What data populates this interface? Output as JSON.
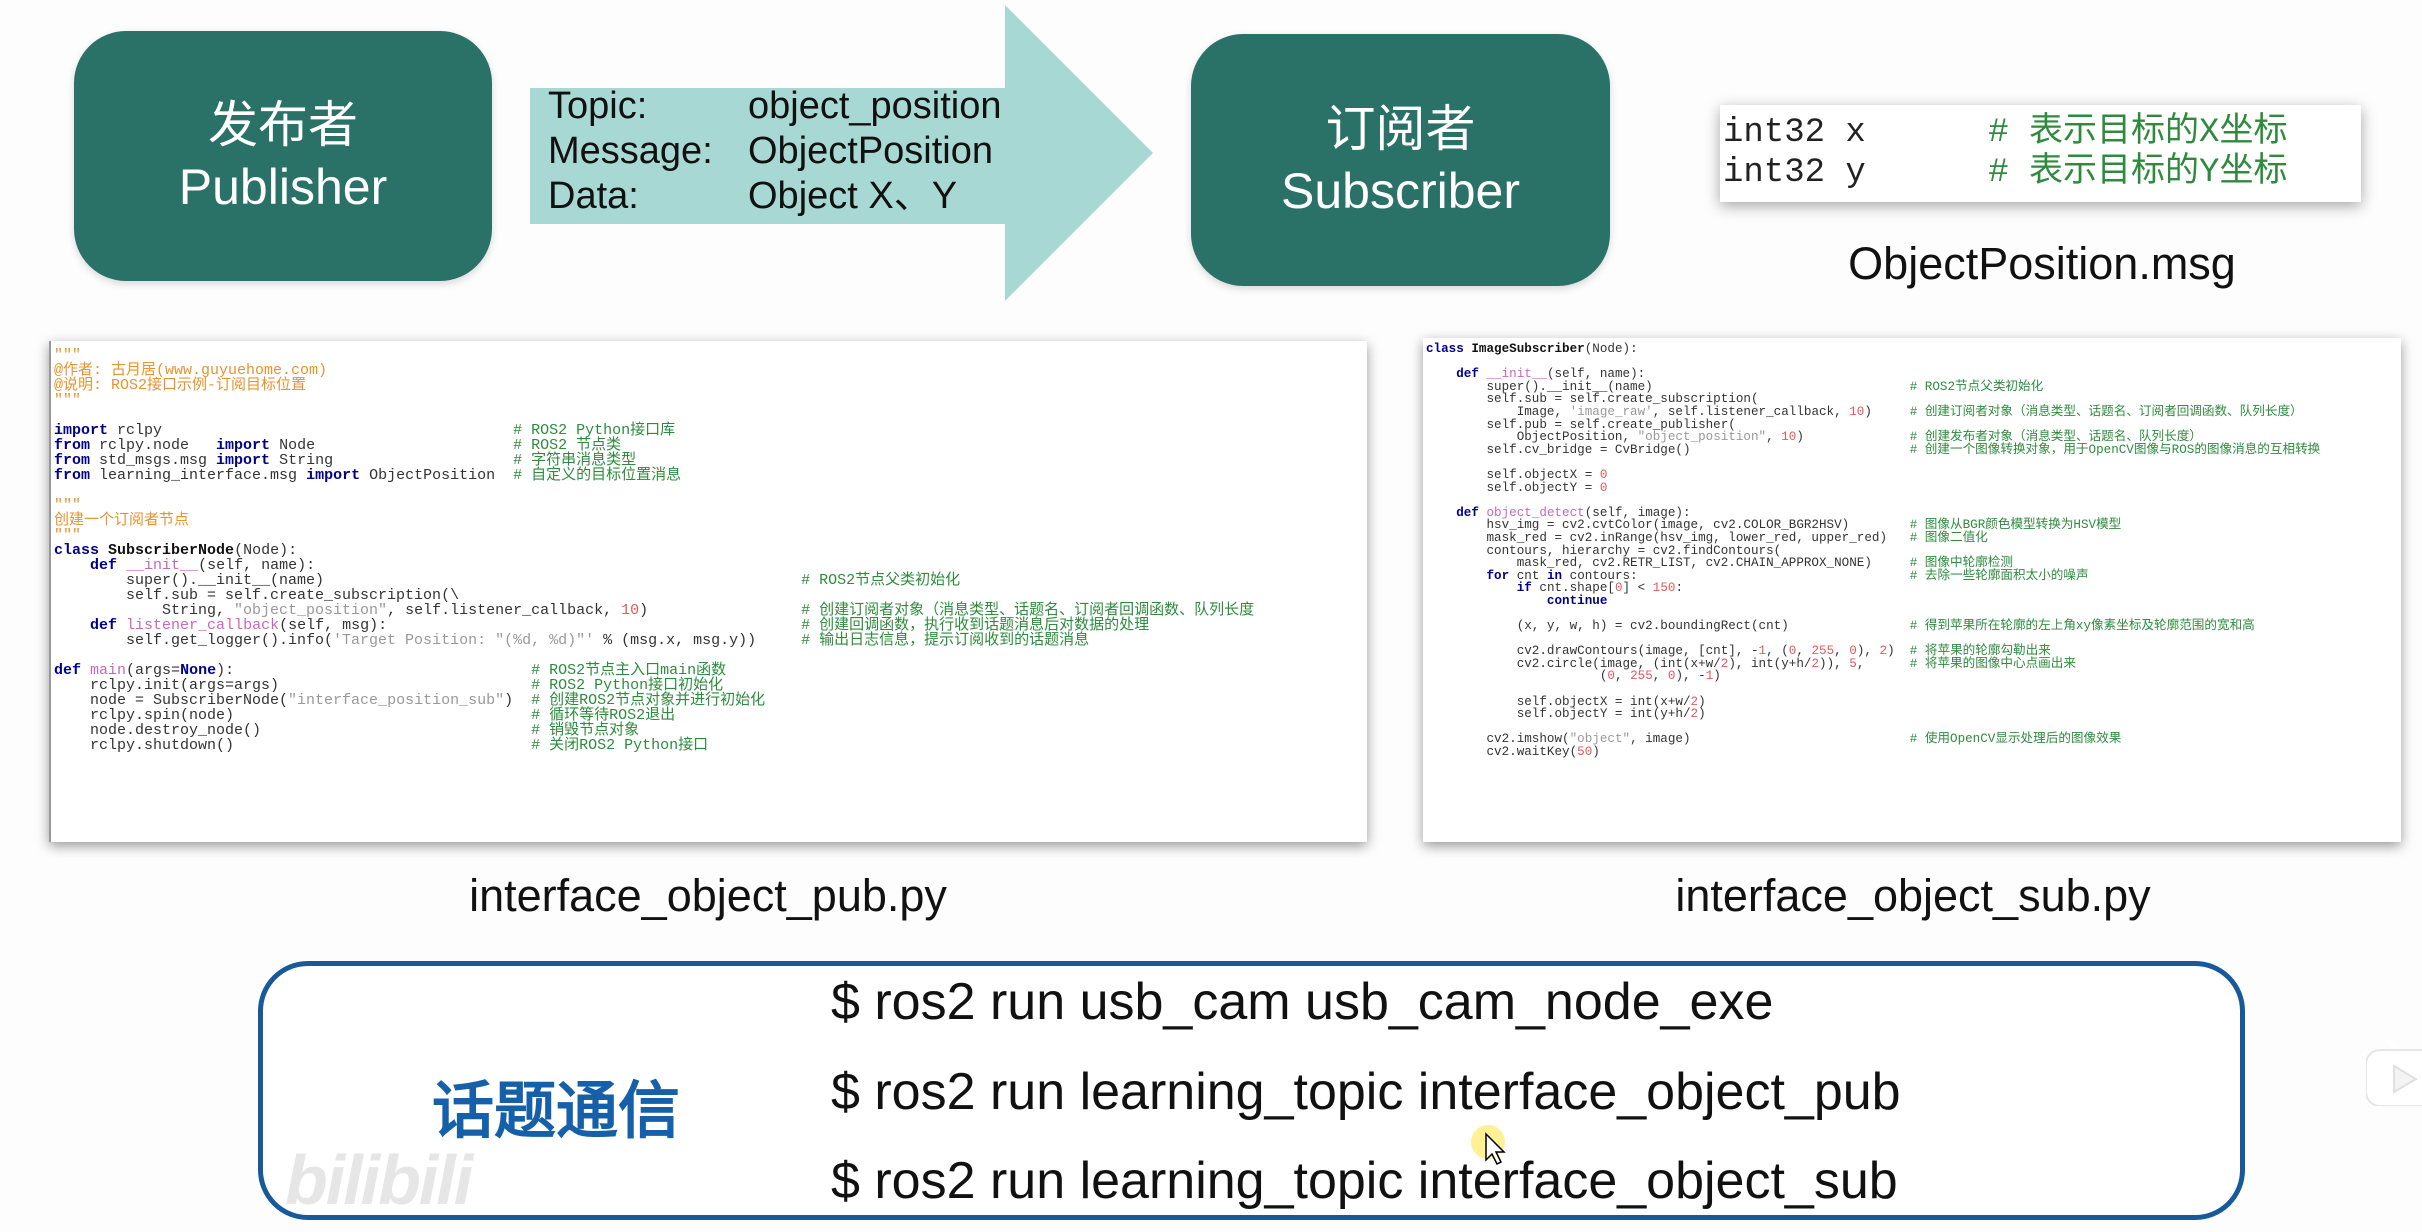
{
  "publisher": {
    "zh": "发布者",
    "en": "Publisher"
  },
  "subscriber": {
    "zh": "订阅者",
    "en": "Subscriber"
  },
  "topic_arrow": {
    "rows": [
      {
        "key": "Topic:",
        "value": "object_position"
      },
      {
        "key": "Message:",
        "value": "ObjectPosition"
      },
      {
        "key": "Data:",
        "value": "Object X、Y"
      }
    ]
  },
  "msg_file": {
    "lines": [
      {
        "code": "int32 x",
        "comment": "# 表示目标的X坐标"
      },
      {
        "code": "int32 y",
        "comment": "# 表示目标的Y坐标"
      }
    ],
    "caption": "ObjectPosition.msg"
  },
  "pub_code": {
    "caption": "interface_object_pub.py",
    "groups": [
      {
        "kind": "doc",
        "lines": [
          "\"\"\"",
          "@作者: 古月居(www.guyuehome.com)",
          "@说明: ROS2接口示例-订阅目标位置",
          "\"\"\"",
          ""
        ]
      },
      {
        "kind": "imports",
        "lines": [
          {
            "code": "import rclpy",
            "comment": "# ROS2 Python接口库"
          },
          {
            "code": "from rclpy.node   import Node",
            "comment": "# ROS2 节点类"
          },
          {
            "code": "from std_msgs.msg import String",
            "comment": "# 字符串消息类型"
          },
          {
            "code": "from learning_interface.msg import ObjectPosition",
            "comment": "# 自定义的目标位置消息"
          },
          {
            "code": "",
            "comment": ""
          }
        ]
      },
      {
        "kind": "doc",
        "lines": [
          "\"\"\"",
          "创建一个订阅者节点",
          "\"\"\""
        ]
      },
      {
        "kind": "class",
        "lines": [
          {
            "code": "class SubscriberNode(Node):",
            "comment": ""
          },
          {
            "code": "    def __init__(self, name):",
            "comment": ""
          },
          {
            "code": "        super().__init__(name)",
            "comment": "# ROS2节点父类初始化"
          },
          {
            "code": "        self.sub = self.create_subscription(\\",
            "comment": ""
          },
          {
            "code": "            String, \"object_position\", self.listener_callback, 10)",
            "comment": "# 创建订阅者对象（消息类型、话题名、订阅者回调函数、队列长度"
          },
          {
            "code": "    def listener_callback(self, msg):",
            "comment": "# 创建回调函数，执行收到话题消息后对数据的处理"
          },
          {
            "code": "        self.get_logger().info('Target Position: \"(%d, %d)\"' % (msg.x, msg.y))",
            "comment": "# 输出日志信息，提示订阅收到的话题消息"
          },
          {
            "code": "",
            "comment": ""
          }
        ]
      },
      {
        "kind": "main",
        "lines": [
          {
            "code": "def main(args=None):",
            "comment": "# ROS2节点主入口main函数"
          },
          {
            "code": "    rclpy.init(args=args)",
            "comment": "# ROS2 Python接口初始化"
          },
          {
            "code": "    node = SubscriberNode(\"interface_position_sub\")",
            "comment": "# 创建ROS2节点对象并进行初始化"
          },
          {
            "code": "    rclpy.spin(node)",
            "comment": "# 循环等待ROS2退出"
          },
          {
            "code": "    node.destroy_node()",
            "comment": "# 销毁节点对象"
          },
          {
            "code": "    rclpy.shutdown()",
            "comment": "# 关闭ROS2 Python接口"
          }
        ]
      }
    ]
  },
  "sub_code": {
    "caption": "interface_object_sub.py",
    "lines": [
      {
        "code": "class ImageSubscriber(Node):",
        "comment": ""
      },
      {
        "code": "",
        "comment": ""
      },
      {
        "code": "    def __init__(self, name):",
        "comment": ""
      },
      {
        "code": "        super().__init__(name)",
        "comment": "# ROS2节点父类初始化"
      },
      {
        "code": "        self.sub = self.create_subscription(",
        "comment": ""
      },
      {
        "code": "            Image, 'image_raw', self.listener_callback, 10)",
        "comment": "# 创建订阅者对象（消息类型、话题名、订阅者回调函数、队列长度）"
      },
      {
        "code": "        self.pub = self.create_publisher(",
        "comment": ""
      },
      {
        "code": "            ObjectPosition, \"object_position\", 10)",
        "comment": "# 创建发布者对象（消息类型、话题名、队列长度）"
      },
      {
        "code": "        self.cv_bridge = CvBridge()",
        "comment": "# 创建一个图像转换对象，用于OpenCV图像与ROS的图像消息的互相转换"
      },
      {
        "code": "",
        "comment": ""
      },
      {
        "code": "        self.objectX = 0",
        "comment": ""
      },
      {
        "code": "        self.objectY = 0",
        "comment": ""
      },
      {
        "code": "",
        "comment": ""
      },
      {
        "code": "    def object_detect(self, image):",
        "comment": ""
      },
      {
        "code": "        hsv_img = cv2.cvtColor(image, cv2.COLOR_BGR2HSV)",
        "comment": "# 图像从BGR颜色模型转换为HSV模型"
      },
      {
        "code": "        mask_red = cv2.inRange(hsv_img, lower_red, upper_red)",
        "comment": "# 图像二值化"
      },
      {
        "code": "        contours, hierarchy = cv2.findContours(",
        "comment": ""
      },
      {
        "code": "            mask_red, cv2.RETR_LIST, cv2.CHAIN_APPROX_NONE)",
        "comment": "# 图像中轮廓检测"
      },
      {
        "code": "        for cnt in contours:",
        "comment": "# 去除一些轮廓面积太小的噪声"
      },
      {
        "code": "            if cnt.shape[0] < 150:",
        "comment": ""
      },
      {
        "code": "                continue",
        "comment": ""
      },
      {
        "code": "",
        "comment": ""
      },
      {
        "code": "            (x, y, w, h) = cv2.boundingRect(cnt)",
        "comment": "# 得到苹果所在轮廓的左上角xy像素坐标及轮廓范围的宽和高"
      },
      {
        "code": "",
        "comment": ""
      },
      {
        "code": "            cv2.drawContours(image, [cnt], -1, (0, 255, 0), 2)",
        "comment": "# 将苹果的轮廓勾勒出来"
      },
      {
        "code": "            cv2.circle(image, (int(x+w/2), int(y+h/2)), 5,",
        "comment": "# 将苹果的图像中心点画出来"
      },
      {
        "code": "                       (0, 255, 0), -1)",
        "comment": ""
      },
      {
        "code": "",
        "comment": ""
      },
      {
        "code": "            self.objectX = int(x+w/2)",
        "comment": ""
      },
      {
        "code": "            self.objectY = int(y+h/2)",
        "comment": ""
      },
      {
        "code": "",
        "comment": ""
      },
      {
        "code": "        cv2.imshow(\"object\", image)",
        "comment": "# 使用OpenCV显示处理后的图像效果"
      },
      {
        "code": "        cv2.waitKey(50)",
        "comment": ""
      }
    ]
  },
  "commands": {
    "title": "话题通信",
    "lines": [
      "$ ros2 run usb_cam usb_cam_node_exe",
      "$ ros2 run learning_topic interface_object_pub",
      "$ ros2 run learning_topic interface_object_sub"
    ]
  },
  "watermark": "bilibili",
  "colors": {
    "node_box": "#2a7167",
    "arrow": "#a8d8d3",
    "command_border": "#17599b",
    "command_title": "#1560a8",
    "comment": "#2e8b3e",
    "keyword": "#00008b",
    "docstring": "#e8932e"
  },
  "icons": {
    "player": "bilibili-tv-icon",
    "cursor": "mouse-cursor-icon"
  }
}
